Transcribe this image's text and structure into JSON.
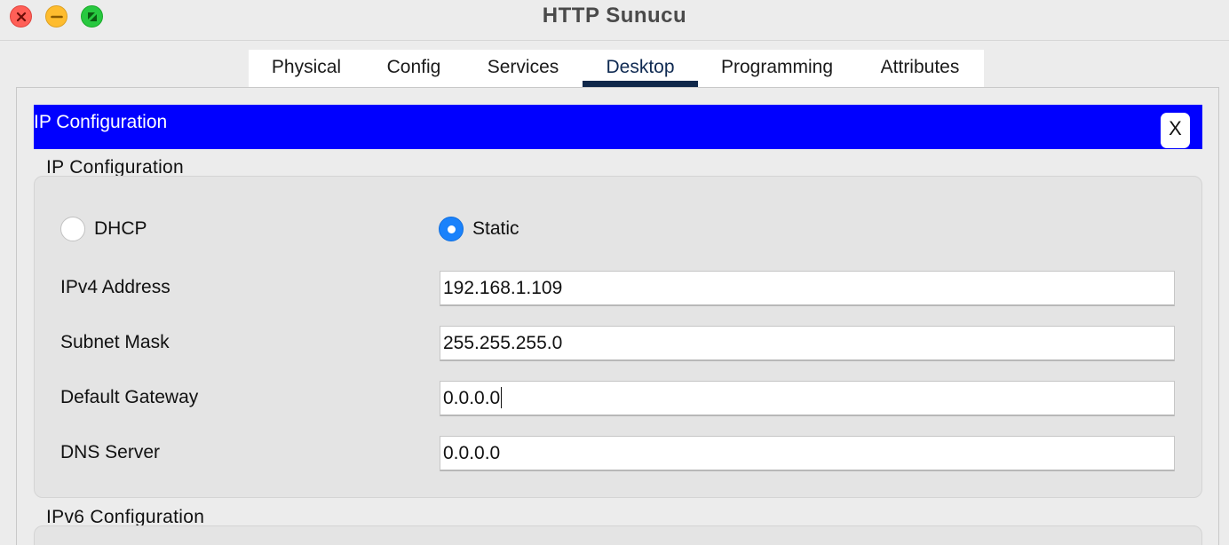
{
  "window": {
    "title": "HTTP Sunucu"
  },
  "tabs": [
    {
      "label": "Physical",
      "active": false
    },
    {
      "label": "Config",
      "active": false
    },
    {
      "label": "Services",
      "active": false
    },
    {
      "label": "Desktop",
      "active": true
    },
    {
      "label": "Programming",
      "active": false
    },
    {
      "label": "Attributes",
      "active": false
    }
  ],
  "app_bar": {
    "title": "IP Configuration",
    "close_label": "X",
    "color": "#0000ff"
  },
  "ipv4": {
    "section_title": "IP Configuration",
    "mode_options": [
      {
        "label": "DHCP",
        "selected": false
      },
      {
        "label": "Static",
        "selected": true
      }
    ],
    "fields": [
      {
        "label": "IPv4 Address",
        "value": "192.168.1.109"
      },
      {
        "label": "Subnet Mask",
        "value": "255.255.255.0"
      },
      {
        "label": "Default Gateway",
        "value": "0.0.0.0"
      },
      {
        "label": "DNS Server",
        "value": "0.0.0.0"
      }
    ]
  },
  "ipv6": {
    "section_title": "IPv6 Configuration"
  },
  "colors": {
    "radio_selected": "#1a82fb",
    "active_tab_indicator": "#10284a"
  }
}
